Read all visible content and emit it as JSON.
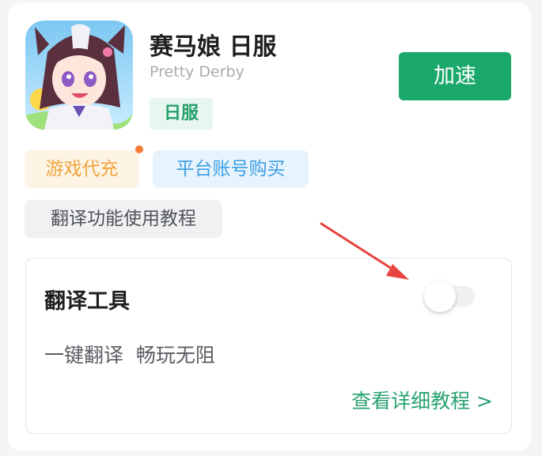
{
  "app": {
    "title": "赛马娘 日服",
    "subtitle": "Pretty Derby",
    "region_tag": "日服",
    "accelerate_label": "加速",
    "icon": "uma-musume-character-app-icon"
  },
  "chips": {
    "recharge": "游戏代充",
    "account_purchase": "平台账号购买",
    "translate_tutorial": "翻译功能使用教程"
  },
  "translate_tool": {
    "title": "翻译工具",
    "description": "一键翻译  畅玩无阻",
    "details_link": "查看详细教程 >",
    "toggle_on": false
  },
  "colors": {
    "accent_green": "#1aa96a",
    "recharge_orange": "#f0a43d",
    "account_blue": "#3c9ee3",
    "annotation_red": "#e8433f",
    "notification_dot": "#f47c33"
  }
}
